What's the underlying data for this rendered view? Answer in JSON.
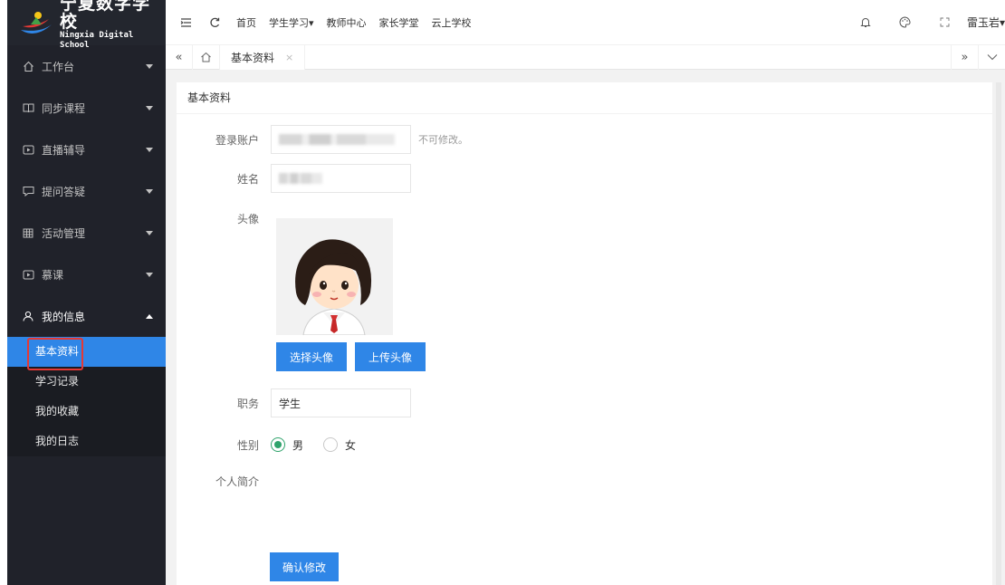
{
  "logo": {
    "title_cn": "宁夏数字学校",
    "title_en": "Ningxia Digital School"
  },
  "sidebar": {
    "items": [
      {
        "label": "工作台",
        "icon": "home-icon"
      },
      {
        "label": "同步课程",
        "icon": "book-icon"
      },
      {
        "label": "直播辅导",
        "icon": "live-icon"
      },
      {
        "label": "提问答疑",
        "icon": "question-icon"
      },
      {
        "label": "活动管理",
        "icon": "grid-icon"
      },
      {
        "label": "慕课",
        "icon": "video-icon"
      },
      {
        "label": "我的信息",
        "icon": "user-icon"
      }
    ],
    "sub_items": [
      "基本资料",
      "学习记录",
      "我的收藏",
      "我的日志"
    ]
  },
  "header": {
    "nav": [
      "首页",
      "学生学习▾",
      "教师中心",
      "家长学堂",
      "云上学校"
    ],
    "user": "雷玉岩▾"
  },
  "tabs": {
    "items": [
      {
        "label": "基本资料",
        "close": "×"
      }
    ]
  },
  "card": {
    "title": "基本资料"
  },
  "form": {
    "account_label": "登录账户",
    "account_hint": "不可修改。",
    "name_label": "姓名",
    "avatar_label": "头像",
    "choose_avatar": "选择头像",
    "upload_avatar": "上传头像",
    "position_label": "职务",
    "position_value": "学生",
    "gender_label": "性别",
    "gender_male": "男",
    "gender_female": "女",
    "gender_selected": "男",
    "bio_label": "个人简介",
    "submit": "确认修改"
  },
  "colors": {
    "sidebar_bg": "#20222a",
    "accent": "#2f86e7",
    "radio_checked": "#2fa36b",
    "highlight_box": "#e53935"
  }
}
